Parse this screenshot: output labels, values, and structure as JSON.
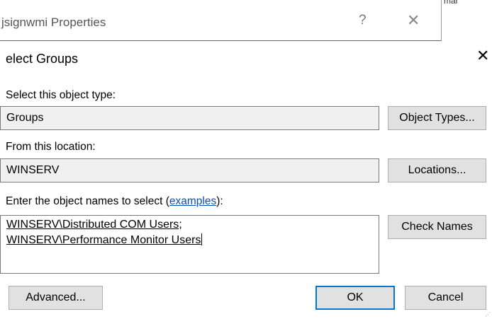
{
  "background_window": {
    "title": "jsignwmi Properties",
    "help_glyph": "?",
    "close_glyph": "✕",
    "edge_fragment": "mar"
  },
  "dialog": {
    "title": "elect Groups",
    "close_glyph": "✕",
    "object_type": {
      "label": "Select this object type:",
      "value": "Groups",
      "button": "Object Types..."
    },
    "location": {
      "label": "From this location:",
      "value": "WINSERV",
      "button": "Locations..."
    },
    "names": {
      "label_prefix": "Enter the object names to select (",
      "label_link": "examples",
      "label_suffix": "):",
      "line1": "WINSERV\\Distributed COM Users",
      "line1_sep": ";",
      "line2": "WINSERV\\Performance Monitor Users",
      "check_button": "Check Names"
    },
    "buttons": {
      "advanced": "Advanced...",
      "ok": "OK",
      "cancel": "Cancel"
    }
  },
  "colors": {
    "accent": "#0078d7",
    "link": "#0b4fb3",
    "button_face": "#e1e1e1",
    "readonly_field": "#f0f0f0"
  },
  "icons": {
    "help": "question-mark-icon",
    "close": "close-icon"
  }
}
